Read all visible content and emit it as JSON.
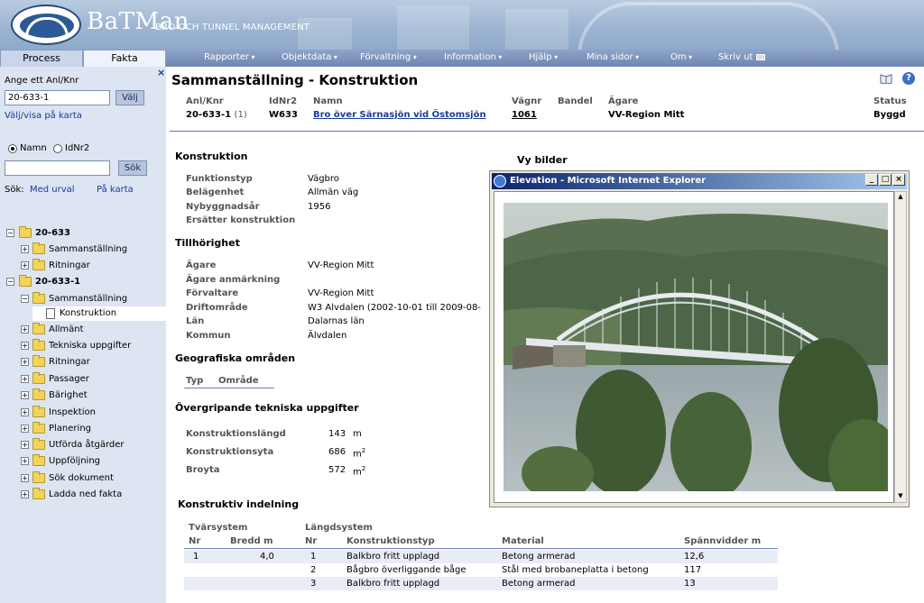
{
  "banner": {
    "brand": "BaTMan",
    "tagline": "BRO OCH TUNNEL MANAGEMENT"
  },
  "tabs": [
    {
      "label": "Process"
    },
    {
      "label": "Fakta"
    }
  ],
  "nav": [
    {
      "label": "Rapporter"
    },
    {
      "label": "Objektdata"
    },
    {
      "label": "Förvaltning"
    },
    {
      "label": "Information"
    },
    {
      "label": "Hjälp"
    },
    {
      "label": "Mina sidor"
    },
    {
      "label": "Om"
    },
    {
      "label": "Skriv ut"
    }
  ],
  "sidebar": {
    "close": "×",
    "prompt": "Ange ett Anl/Knr",
    "anl_value": "20-633-1",
    "valj_label": "Välj",
    "valj_link": "Välj/visa på karta",
    "radio_namn": "Namn",
    "radio_idnr": "IdNr2",
    "search_value": "",
    "sok_label": "Sök",
    "sok_prefix": "Sök:",
    "sok_urval": "Med urval",
    "sok_karta": "På karta",
    "tree": [
      {
        "label": "20-633"
      },
      {
        "label": "Sammanställning"
      },
      {
        "label": "Ritningar"
      },
      {
        "label": "20-633-1"
      },
      {
        "label": "Sammanställning"
      },
      {
        "label": "Konstruktion"
      },
      {
        "label": "Allmänt"
      },
      {
        "label": "Tekniska uppgifter"
      },
      {
        "label": "Ritningar"
      },
      {
        "label": "Passager"
      },
      {
        "label": "Bärighet"
      },
      {
        "label": "Inspektion"
      },
      {
        "label": "Planering"
      },
      {
        "label": "Utförda åtgärder"
      },
      {
        "label": "Uppföljning"
      },
      {
        "label": "Sök dokument"
      },
      {
        "label": "Ladda ned fakta"
      }
    ]
  },
  "main": {
    "title": "Sammanställning - Konstruktion",
    "header": {
      "anl_label": "Anl/Knr",
      "anl_value": "20-633-1",
      "anl_count": "(1)",
      "idnr_label": "IdNr2",
      "idnr_value": "W633",
      "namn_label": "Namn",
      "namn_value": "Bro över Särnasjön vid Östomsjön",
      "vagnr_label": "Vägnr",
      "vagnr_value": "1061",
      "bandel_label": "Bandel",
      "agare_label": "Ägare",
      "agare_value": "VV-Region Mitt",
      "status_label": "Status",
      "status_value": "Byggd"
    },
    "konstruktion": {
      "title": "Konstruktion",
      "rows": [
        {
          "k": "Funktionstyp",
          "v": "Vägbro"
        },
        {
          "k": "Belägenhet",
          "v": "Allmän väg"
        },
        {
          "k": "Nybyggnadsår",
          "v": "1956"
        },
        {
          "k": "Ersätter konstruktion",
          "v": ""
        }
      ]
    },
    "tillhorighet": {
      "title": "Tillhörighet",
      "rows": [
        {
          "k": "Ägare",
          "v": "VV-Region Mitt"
        },
        {
          "k": "Ägare anmärkning",
          "v": ""
        },
        {
          "k": "Förvaltare",
          "v": "VV-Region Mitt"
        },
        {
          "k": "Driftområde",
          "v": "W3 Älvdalen (2002-10-01 till 2009-08-"
        },
        {
          "k": "Län",
          "v": "Dalarnas län"
        },
        {
          "k": "Kommun",
          "v": "Älvdalen"
        }
      ]
    },
    "geo": {
      "title": "Geografiska områden",
      "col_typ": "Typ",
      "col_omrade": "Område"
    },
    "tekn": {
      "title": "Övergripande tekniska uppgifter",
      "rows": [
        {
          "k": "Konstruktionslängd",
          "v": "143",
          "u": "m",
          "sup": ""
        },
        {
          "k": "Konstruktionsyta",
          "v": "686",
          "u": "m",
          "sup": "2"
        },
        {
          "k": "Broyta",
          "v": "572",
          "u": "m",
          "sup": "2"
        }
      ]
    },
    "vy_bilder": "Vy bilder",
    "indelning": {
      "title": "Konstruktiv indelning",
      "group_tvar": "Tvärsystem",
      "group_langd": "Längdsystem",
      "headers": [
        "Nr",
        "Bredd m",
        "Nr",
        "Konstruktionstyp",
        "Material",
        "Spännvidder m"
      ],
      "rows": [
        [
          "1",
          "4,0",
          "1",
          "Balkbro fritt upplagd",
          "Betong armerad",
          "12,6"
        ],
        [
          "",
          "",
          "2",
          "Bågbro överliggande båge",
          "Stål med brobaneplatta i betong",
          "117"
        ],
        [
          "",
          "",
          "3",
          "Balkbro fritt upplagd",
          "Betong armerad",
          "13"
        ]
      ]
    }
  },
  "popup": {
    "title": "Elevation - Microsoft Internet Explorer",
    "min": "_",
    "max": "□",
    "close": "×"
  },
  "colors": {
    "nav": "#7b93bb",
    "sidebar": "#dde4f2",
    "link": "#1a3c9a",
    "rule": "#5a7aa8"
  }
}
